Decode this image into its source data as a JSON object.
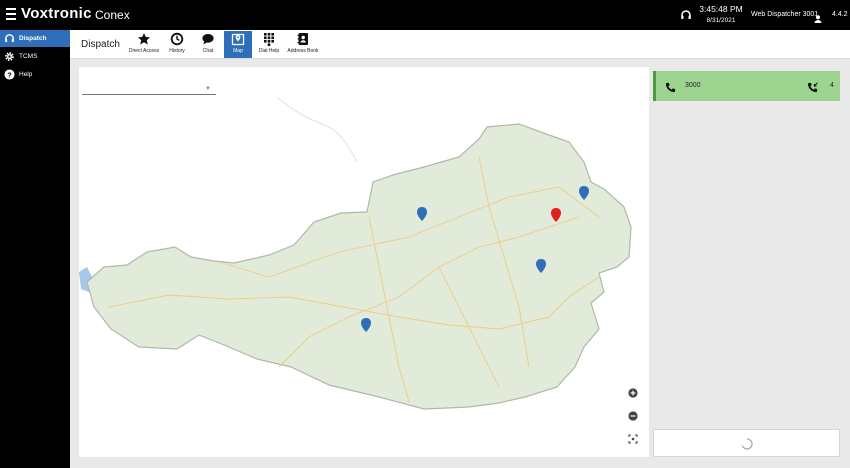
{
  "header": {
    "brand": "Voxtronic",
    "product": "Conex",
    "time": "3:45:48 PM",
    "date": "8/31/2021",
    "user": "Web Dispatcher 3001",
    "version": "4.4.2"
  },
  "sidebar": {
    "items": [
      {
        "label": "Dispatch",
        "icon": "headset-icon",
        "active": true
      },
      {
        "label": "TCMS",
        "icon": "gear-icon",
        "active": false
      },
      {
        "label": "Help",
        "icon": "help-icon",
        "active": false
      }
    ]
  },
  "toolbar": {
    "title": "Dispatch",
    "buttons": [
      {
        "label": "Direct Access",
        "icon": "star-icon"
      },
      {
        "label": "History",
        "icon": "clock-icon"
      },
      {
        "label": "Chat",
        "icon": "chat-icon"
      },
      {
        "label": "Map",
        "icon": "map-icon",
        "active": true
      },
      {
        "label": "Dial Help",
        "icon": "keypad-icon"
      },
      {
        "label": "Address Book",
        "icon": "address-book-icon"
      }
    ]
  },
  "map": {
    "region": "Austria",
    "select_value": "",
    "markers": [
      {
        "color": "#2f6fba"
      },
      {
        "color": "#2f6fba"
      },
      {
        "color": "#e02020"
      },
      {
        "color": "#2f6fba"
      },
      {
        "color": "#2f6fba"
      }
    ]
  },
  "calls": [
    {
      "number": "3000",
      "count": "4"
    }
  ],
  "colors": {
    "accent": "#2f6fba",
    "call_bg": "#9dd48f",
    "call_border": "#4c9a40",
    "marker_alert": "#e02020"
  }
}
